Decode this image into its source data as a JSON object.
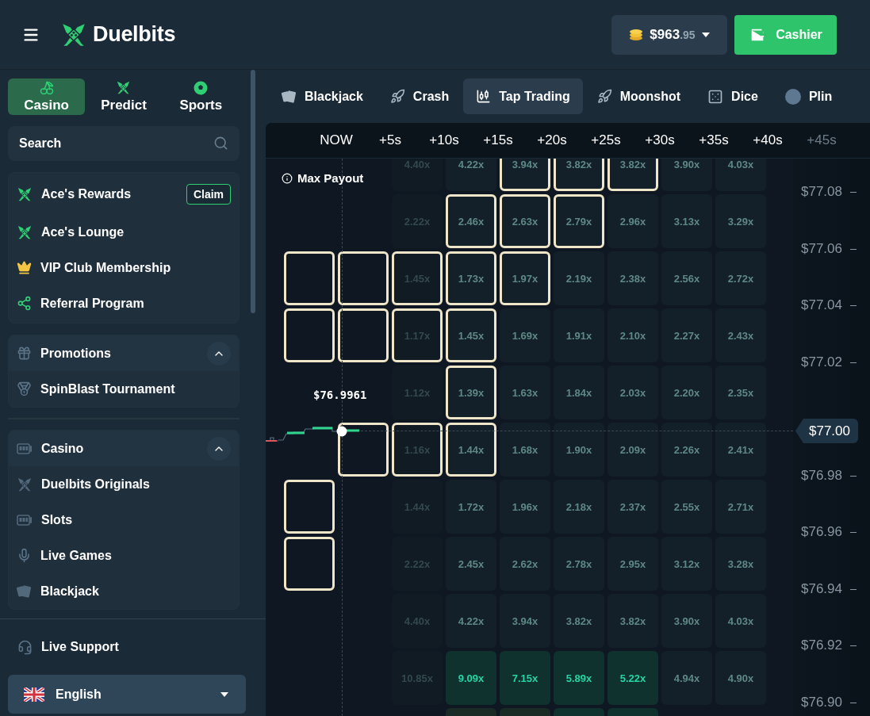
{
  "topbar": {
    "brand": "Duelbits",
    "balance": {
      "whole": "$963",
      "cents": ".95"
    },
    "cashier": "Cashier"
  },
  "sidebar": {
    "sections": [
      {
        "label": "Casino",
        "selected": true
      },
      {
        "label": "Predict",
        "selected": false
      },
      {
        "label": "Sports",
        "selected": false
      }
    ],
    "search": {
      "placeholder": "Search"
    },
    "links": [
      {
        "label": "Ace's Rewards",
        "action": "Claim"
      },
      {
        "label": "Ace's Lounge"
      },
      {
        "label": "VIP Club Membership"
      },
      {
        "label": "Referral Program"
      }
    ],
    "groups": [
      {
        "title": "Promotions",
        "expanded": true,
        "items": [
          "SpinBlast Tournament"
        ]
      },
      {
        "title": "Casino",
        "expanded": true,
        "items": [
          "Duelbits Originals",
          "Slots",
          "Live Games",
          "Blackjack"
        ]
      }
    ],
    "support": "Live Support",
    "language": "English"
  },
  "game_tabs": [
    {
      "label": "Blackjack",
      "selected": false
    },
    {
      "label": "Crash",
      "selected": false
    },
    {
      "label": "Tap Trading",
      "selected": true
    },
    {
      "label": "Moonshot",
      "selected": false
    },
    {
      "label": "Dice",
      "selected": false
    },
    {
      "label": "Plin",
      "selected": false
    }
  ],
  "board": {
    "times": [
      {
        "label": "NOW",
        "faded": false
      },
      {
        "label": "+5s",
        "faded": false
      },
      {
        "label": "+10s",
        "faded": false
      },
      {
        "label": "+15s",
        "faded": false
      },
      {
        "label": "+20s",
        "faded": false
      },
      {
        "label": "+25s",
        "faded": false
      },
      {
        "label": "+30s",
        "faded": false
      },
      {
        "label": "+35s",
        "faded": false
      },
      {
        "label": "+40s",
        "faded": false
      },
      {
        "label": "+45s",
        "faded": true
      }
    ],
    "max_payout": "Max Payout",
    "current_price": "$76.9961",
    "rows": [
      {
        "cells": [
          {
            "kind": "empty",
            "selected": false
          },
          {
            "kind": "empty",
            "selected": false
          },
          {
            "text": "4.40x",
            "kind": "past",
            "selected": false
          },
          {
            "text": "4.22x",
            "kind": "normal",
            "selected": false
          },
          {
            "text": "3.94x",
            "kind": "normal",
            "selected": true
          },
          {
            "text": "3.82x",
            "kind": "normal",
            "selected": true
          },
          {
            "text": "3.82x",
            "kind": "normal",
            "selected": true
          },
          {
            "text": "3.90x",
            "kind": "normal",
            "selected": false
          },
          {
            "text": "4.03x",
            "kind": "normal",
            "selected": false
          }
        ]
      },
      {
        "cells": [
          {
            "kind": "empty",
            "selected": false
          },
          {
            "kind": "empty",
            "selected": false
          },
          {
            "text": "2.22x",
            "kind": "past",
            "selected": false
          },
          {
            "text": "2.46x",
            "kind": "normal",
            "selected": true
          },
          {
            "text": "2.63x",
            "kind": "normal",
            "selected": true
          },
          {
            "text": "2.79x",
            "kind": "normal",
            "selected": true
          },
          {
            "text": "2.96x",
            "kind": "normal",
            "selected": false
          },
          {
            "text": "3.13x",
            "kind": "normal",
            "selected": false
          },
          {
            "text": "3.29x",
            "kind": "normal",
            "selected": false
          }
        ]
      },
      {
        "cells": [
          {
            "kind": "empty",
            "selected": true
          },
          {
            "kind": "empty",
            "selected": true
          },
          {
            "text": "1.45x",
            "kind": "past",
            "selected": true
          },
          {
            "text": "1.73x",
            "kind": "normal",
            "selected": true
          },
          {
            "text": "1.97x",
            "kind": "normal",
            "selected": true
          },
          {
            "text": "2.19x",
            "kind": "normal",
            "selected": false
          },
          {
            "text": "2.38x",
            "kind": "normal",
            "selected": false
          },
          {
            "text": "2.56x",
            "kind": "normal",
            "selected": false
          },
          {
            "text": "2.72x",
            "kind": "normal",
            "selected": false
          }
        ]
      },
      {
        "cells": [
          {
            "kind": "empty",
            "selected": true
          },
          {
            "kind": "empty",
            "selected": true
          },
          {
            "text": "1.17x",
            "kind": "past",
            "selected": true
          },
          {
            "text": "1.45x",
            "kind": "normal",
            "selected": true
          },
          {
            "text": "1.69x",
            "kind": "normal",
            "selected": false
          },
          {
            "text": "1.91x",
            "kind": "normal",
            "selected": false
          },
          {
            "text": "2.10x",
            "kind": "normal",
            "selected": false
          },
          {
            "text": "2.27x",
            "kind": "normal",
            "selected": false
          },
          {
            "text": "2.43x",
            "kind": "normal",
            "selected": false
          }
        ]
      },
      {
        "cells": [
          {
            "kind": "empty",
            "selected": false
          },
          {
            "kind": "empty",
            "selected": false
          },
          {
            "text": "1.12x",
            "kind": "past",
            "selected": false
          },
          {
            "text": "1.39x",
            "kind": "normal",
            "selected": true
          },
          {
            "text": "1.63x",
            "kind": "normal",
            "selected": false
          },
          {
            "text": "1.84x",
            "kind": "normal",
            "selected": false
          },
          {
            "text": "2.03x",
            "kind": "normal",
            "selected": false
          },
          {
            "text": "2.20x",
            "kind": "normal",
            "selected": false
          },
          {
            "text": "2.35x",
            "kind": "normal",
            "selected": false
          }
        ]
      },
      {
        "cells": [
          {
            "kind": "empty",
            "selected": false
          },
          {
            "kind": "empty",
            "selected": true
          },
          {
            "text": "1.16x",
            "kind": "past",
            "selected": true
          },
          {
            "text": "1.44x",
            "kind": "normal",
            "selected": true
          },
          {
            "text": "1.68x",
            "kind": "normal",
            "selected": false
          },
          {
            "text": "1.90x",
            "kind": "normal",
            "selected": false
          },
          {
            "text": "2.09x",
            "kind": "normal",
            "selected": false
          },
          {
            "text": "2.26x",
            "kind": "normal",
            "selected": false
          },
          {
            "text": "2.41x",
            "kind": "normal",
            "selected": false
          }
        ]
      },
      {
        "cells": [
          {
            "kind": "empty",
            "selected": true
          },
          {
            "kind": "empty",
            "selected": false
          },
          {
            "text": "1.44x",
            "kind": "past",
            "selected": false
          },
          {
            "text": "1.72x",
            "kind": "normal",
            "selected": false
          },
          {
            "text": "1.96x",
            "kind": "normal",
            "selected": false
          },
          {
            "text": "2.18x",
            "kind": "normal",
            "selected": false
          },
          {
            "text": "2.37x",
            "kind": "normal",
            "selected": false
          },
          {
            "text": "2.55x",
            "kind": "normal",
            "selected": false
          },
          {
            "text": "2.71x",
            "kind": "normal",
            "selected": false
          }
        ]
      },
      {
        "cells": [
          {
            "kind": "empty",
            "selected": true
          },
          {
            "kind": "empty",
            "selected": false
          },
          {
            "text": "2.22x",
            "kind": "past",
            "selected": false
          },
          {
            "text": "2.45x",
            "kind": "normal",
            "selected": false
          },
          {
            "text": "2.62x",
            "kind": "normal",
            "selected": false
          },
          {
            "text": "2.78x",
            "kind": "normal",
            "selected": false
          },
          {
            "text": "2.95x",
            "kind": "normal",
            "selected": false
          },
          {
            "text": "3.12x",
            "kind": "normal",
            "selected": false
          },
          {
            "text": "3.28x",
            "kind": "normal",
            "selected": false
          }
        ]
      },
      {
        "cells": [
          {
            "kind": "empty",
            "selected": false
          },
          {
            "kind": "empty",
            "selected": false
          },
          {
            "text": "4.40x",
            "kind": "past",
            "selected": false
          },
          {
            "text": "4.22x",
            "kind": "normal",
            "selected": false
          },
          {
            "text": "3.94x",
            "kind": "normal",
            "selected": false
          },
          {
            "text": "3.82x",
            "kind": "normal",
            "selected": false
          },
          {
            "text": "3.82x",
            "kind": "normal",
            "selected": false
          },
          {
            "text": "3.90x",
            "kind": "normal",
            "selected": false
          },
          {
            "text": "4.03x",
            "kind": "normal",
            "selected": false
          }
        ]
      },
      {
        "cells": [
          {
            "kind": "empty",
            "selected": false
          },
          {
            "kind": "empty",
            "selected": false
          },
          {
            "text": "10.85x",
            "kind": "past",
            "selected": false
          },
          {
            "text": "9.09x",
            "kind": "hot",
            "selected": false
          },
          {
            "text": "7.15x",
            "kind": "hot",
            "selected": false
          },
          {
            "text": "5.89x",
            "kind": "hot",
            "selected": false
          },
          {
            "text": "5.22x",
            "kind": "hot",
            "selected": false
          },
          {
            "text": "4.94x",
            "kind": "normal",
            "selected": false
          },
          {
            "text": "4.90x",
            "kind": "normal",
            "selected": false
          }
        ]
      },
      {
        "cells": [
          {
            "kind": "empty",
            "selected": false
          },
          {
            "kind": "empty",
            "selected": false
          },
          {
            "kind": "empty",
            "selected": false
          },
          {
            "kind": "warm",
            "selected": false
          },
          {
            "kind": "warm",
            "selected": false
          },
          {
            "kind": "hot",
            "selected": false
          },
          {
            "kind": "hot",
            "selected": false
          },
          {
            "kind": "empty",
            "selected": false
          },
          {
            "kind": "empty",
            "selected": false
          }
        ]
      }
    ],
    "axis": [
      {
        "label": "$77.08",
        "kind": "tick"
      },
      {
        "label": "$77.06",
        "kind": "tick"
      },
      {
        "label": "$77.04",
        "kind": "tick"
      },
      {
        "label": "$77.02",
        "kind": "tick"
      },
      {
        "label": "$77.00",
        "kind": "current"
      },
      {
        "label": "$76.98",
        "kind": "tick"
      },
      {
        "label": "$76.96",
        "kind": "tick"
      },
      {
        "label": "$76.94",
        "kind": "tick"
      },
      {
        "label": "$76.92",
        "kind": "tick"
      },
      {
        "label": "$76.90",
        "kind": "tick"
      }
    ]
  }
}
